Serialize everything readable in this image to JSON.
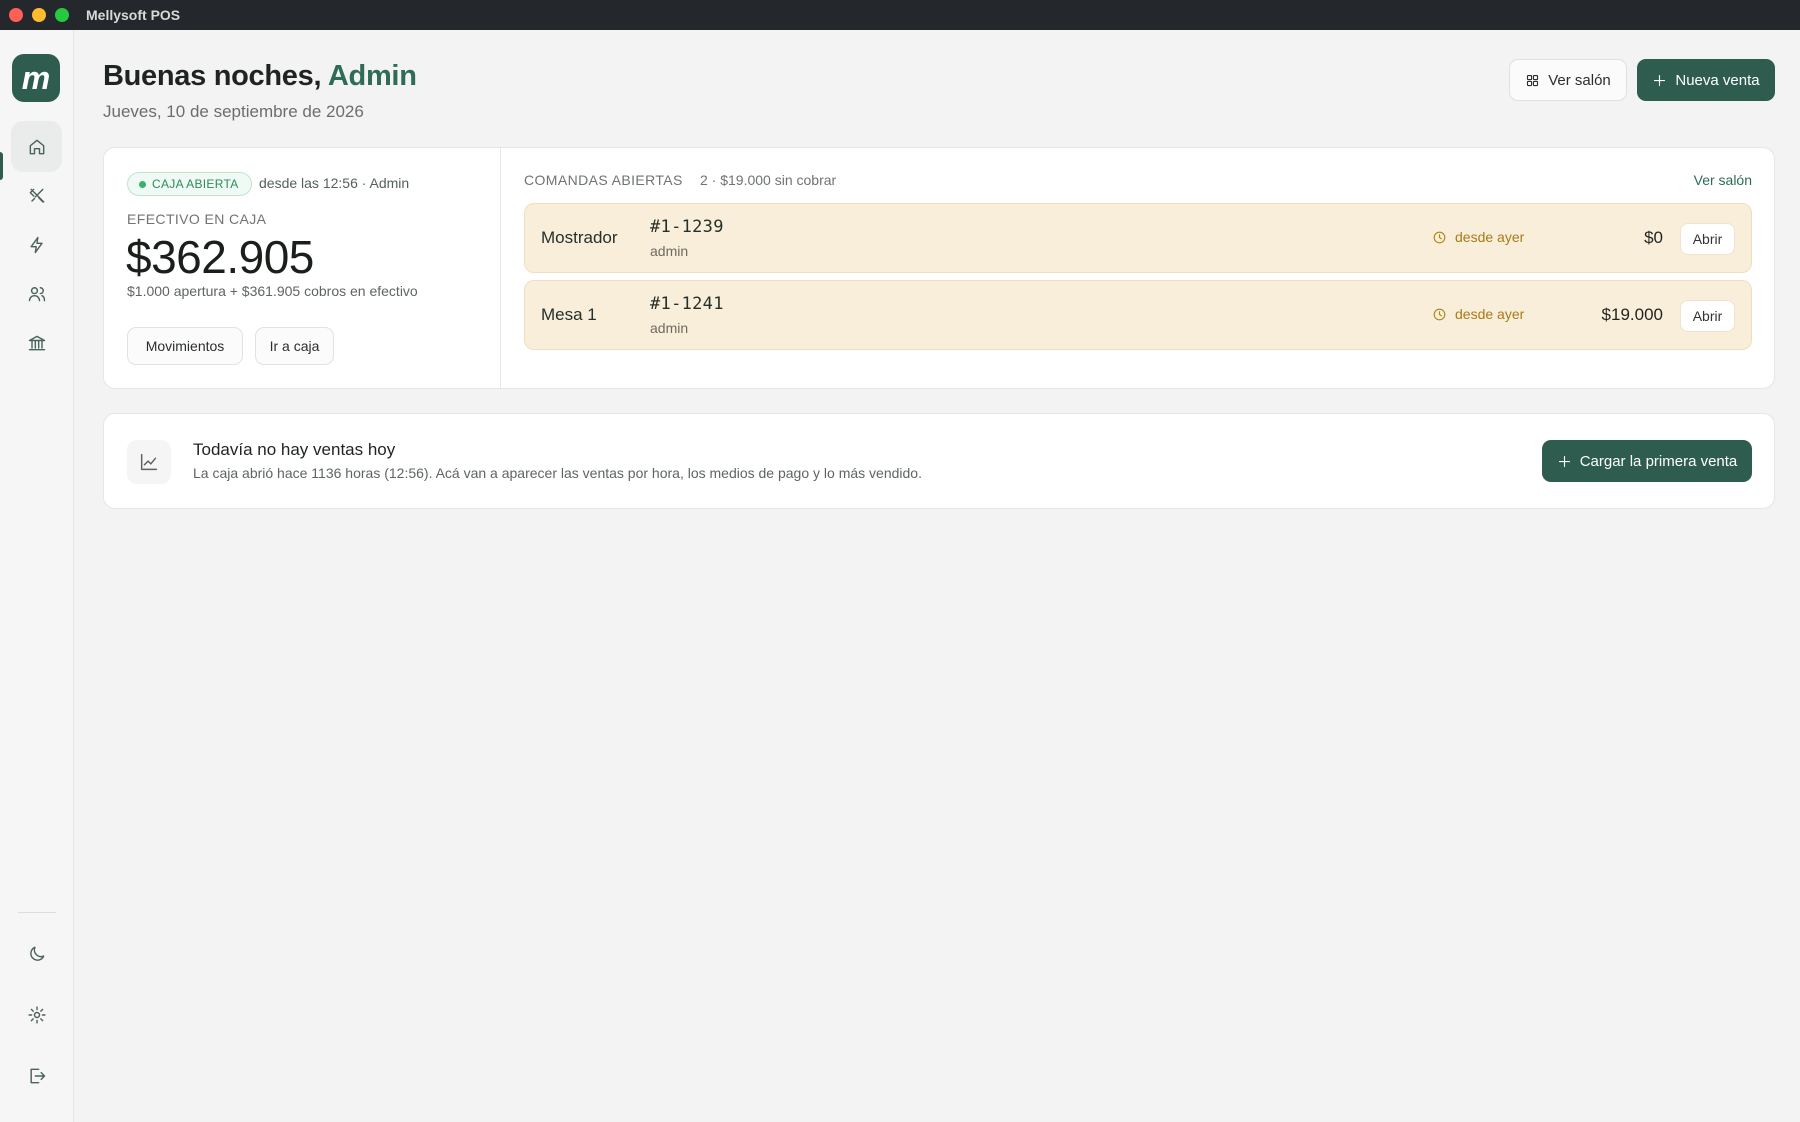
{
  "window": {
    "title": "Mellysoft POS"
  },
  "sidebar": {
    "logo_letter": "m",
    "items": [
      {
        "name": "home",
        "icon": "home-icon",
        "active": true
      },
      {
        "name": "orders",
        "icon": "utensils-icon",
        "active": false
      },
      {
        "name": "quick-sale",
        "icon": "lightning-icon",
        "active": false
      },
      {
        "name": "customers",
        "icon": "users-icon",
        "active": false
      },
      {
        "name": "bank",
        "icon": "bank-icon",
        "active": false
      }
    ],
    "bottom_items": [
      {
        "name": "theme",
        "icon": "moon-icon"
      },
      {
        "name": "settings",
        "icon": "gear-icon"
      },
      {
        "name": "logout",
        "icon": "logout-icon"
      }
    ]
  },
  "header": {
    "greeting": "Buenas noches,",
    "user_name": "Admin",
    "date": "Jueves, 10 de septiembre de 2026",
    "view_room_label": "Ver salón",
    "new_sale_label": "Nueva venta"
  },
  "cash": {
    "status_badge": "CAJA ABIERTA",
    "since": "desde las 12:56 · Admin",
    "label": "EFECTIVO EN CAJA",
    "amount": "$362.905",
    "detail": "$1.000 apertura + $361.905 cobros en efectivo",
    "movements_label": "Movimientos",
    "go_to_cash_label": "Ir a caja"
  },
  "orders": {
    "title": "COMANDAS ABIERTAS",
    "summary": "2 · $19.000 sin cobrar",
    "view_room_link": "Ver salón",
    "rows": [
      {
        "place": "Mostrador",
        "number": "#1-1239",
        "user": "admin",
        "time": "desde ayer",
        "total": "$0",
        "open_label": "Abrir"
      },
      {
        "place": "Mesa 1",
        "number": "#1-1241",
        "user": "admin",
        "time": "desde ayer",
        "total": "$19.000",
        "open_label": "Abrir"
      }
    ]
  },
  "empty_sales": {
    "title": "Todavía no hay ventas hoy",
    "description": "La caja abrió hace 1136 horas (12:56). Acá van a aparecer las ventas por hora, los medios de pago y lo más vendido.",
    "button_label": "Cargar la primera venta"
  },
  "colors": {
    "brand": "#2e5c4f",
    "accent_text": "#2e6b58",
    "order_bg": "#f9eed9",
    "status_green": "#34b36a",
    "warning": "#a77b18"
  }
}
